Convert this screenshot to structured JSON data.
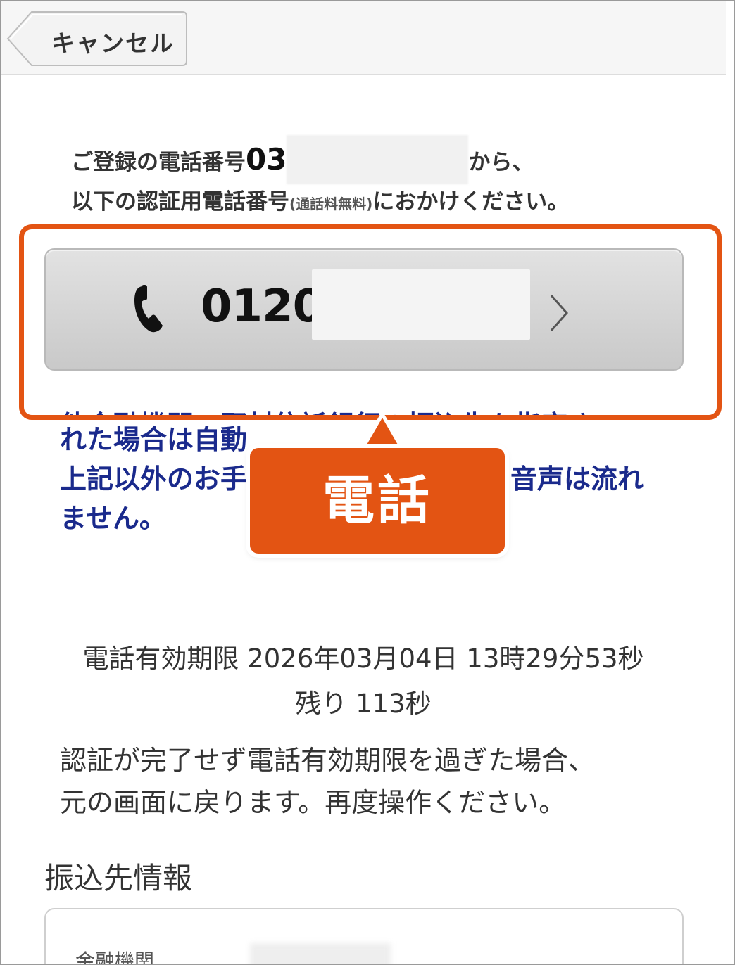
{
  "header": {
    "cancel_label": "キャンセル"
  },
  "intro": {
    "line1_prefix": "ご登録の電話番号",
    "registered_number_visible": "03",
    "line1_suffix": "から、",
    "line2_main": "以下の認証用電話番号",
    "line2_note": "(通話料無料)",
    "line2_suffix": "におかけください。"
  },
  "call_button": {
    "number_visible": "0120-",
    "icon": "phone-icon",
    "chevron_icon": "chevron-right-icon"
  },
  "notice": {
    "line1": "他金融機関・野村信託銀行の振込先を指定さ",
    "line2": "れた場合は自動",
    "line3_start": "上記以外のお手",
    "line3_end": "音声は流れ",
    "line4": "ません。"
  },
  "callout": {
    "label": "電話",
    "color": "#e35413"
  },
  "expiry": {
    "label": "電話有効期限",
    "datetime": "2026年03月04日 13時29分53秒",
    "remaining_label": "残り",
    "remaining_value": "113秒"
  },
  "timeout_note": {
    "line1": "認証が完了せず電話有効期限を過ぎた場合、",
    "line2": "元の画面に戻ります。再度操作ください。"
  },
  "transfer_section": {
    "title": "振込先情報",
    "first_field_label": "金融機関"
  },
  "colors": {
    "highlight": "#e35413",
    "notice_text": "#1a2a8c",
    "button_bg": "#d3d3d3"
  }
}
